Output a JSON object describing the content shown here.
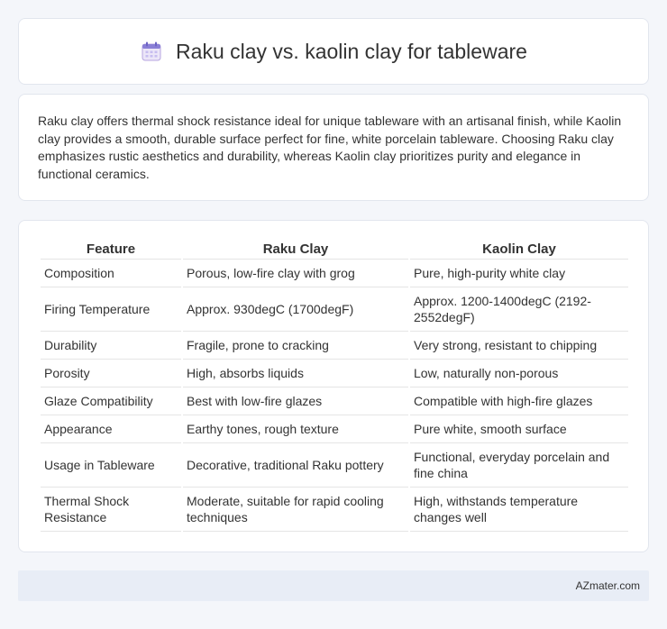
{
  "header": {
    "title": "Raku clay vs. kaolin clay for tableware",
    "icon": "calendar-icon"
  },
  "intro": {
    "text": "Raku clay offers thermal shock resistance ideal for unique tableware with an artisanal finish, while Kaolin clay provides a smooth, durable surface perfect for fine, white porcelain tableware. Choosing Raku clay emphasizes rustic aesthetics and durability, whereas Kaolin clay prioritizes purity and elegance in functional ceramics."
  },
  "table": {
    "headers": [
      "Feature",
      "Raku Clay",
      "Kaolin Clay"
    ],
    "rows": [
      [
        "Composition",
        "Porous, low-fire clay with grog",
        "Pure, high-purity white clay"
      ],
      [
        "Firing Temperature",
        "Approx. 930degC (1700degF)",
        "Approx. 1200-1400degC (2192-2552degF)"
      ],
      [
        "Durability",
        "Fragile, prone to cracking",
        "Very strong, resistant to chipping"
      ],
      [
        "Porosity",
        "High, absorbs liquids",
        "Low, naturally non-porous"
      ],
      [
        "Glaze Compatibility",
        "Best with low-fire glazes",
        "Compatible with high-fire glazes"
      ],
      [
        "Appearance",
        "Earthy tones, rough texture",
        "Pure white, smooth surface"
      ],
      [
        "Usage in Tableware",
        "Decorative, traditional Raku pottery",
        "Functional, everyday porcelain and fine china"
      ],
      [
        "Thermal Shock Resistance",
        "Moderate, suitable for rapid cooling techniques",
        "High, withstands temperature changes well"
      ]
    ]
  },
  "footer": {
    "text": "AZmater.com"
  }
}
